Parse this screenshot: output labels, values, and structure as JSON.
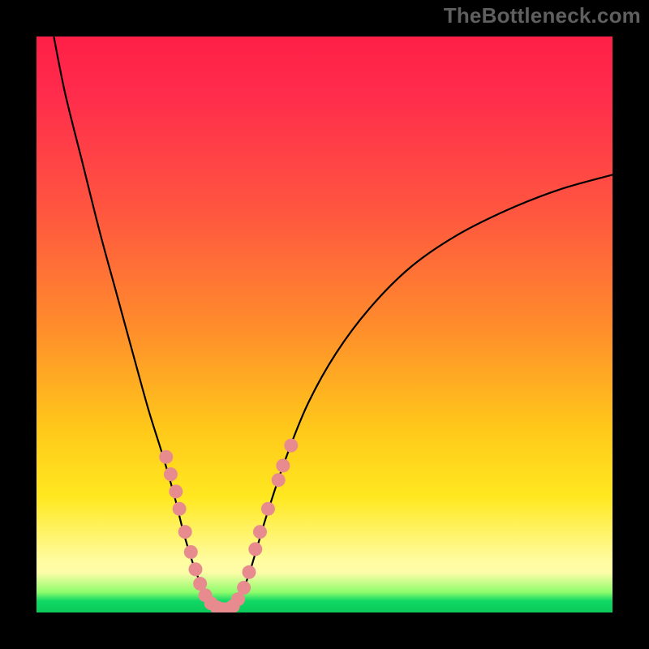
{
  "watermark": "TheBottleneck.com",
  "colors": {
    "frame": "#000000",
    "curve": "#000000",
    "marker": "#e88b8f",
    "gradient_top": "#ff1f47",
    "gradient_bottom": "#0bc95a"
  },
  "chart_data": {
    "type": "line",
    "title": "",
    "xlabel": "",
    "ylabel": "",
    "xlim": [
      0,
      100
    ],
    "ylim": [
      0,
      100
    ],
    "series": [
      {
        "name": "left-arm",
        "x": [
          3,
          5,
          8,
          11,
          14,
          17,
          19.5,
          22,
          24,
          25.5,
          27,
          28.5,
          30,
          31
        ],
        "y": [
          100,
          90,
          78,
          66,
          55,
          44,
          35,
          27,
          20,
          14,
          9,
          5,
          2,
          0.5
        ]
      },
      {
        "name": "right-arm",
        "x": [
          34,
          35.5,
          37,
          38.5,
          40,
          43,
          47,
          52,
          58,
          65,
          73,
          82,
          91,
          100
        ],
        "y": [
          0.5,
          3,
          7,
          12,
          17,
          26,
          36,
          45,
          53,
          60,
          65.5,
          70,
          73.5,
          76
        ]
      }
    ],
    "markers": {
      "name": "highlight-points",
      "points": [
        {
          "x": 22.5,
          "y": 27
        },
        {
          "x": 23.3,
          "y": 24
        },
        {
          "x": 24.2,
          "y": 21
        },
        {
          "x": 24.8,
          "y": 18
        },
        {
          "x": 25.8,
          "y": 14
        },
        {
          "x": 26.8,
          "y": 10.5
        },
        {
          "x": 27.6,
          "y": 7.5
        },
        {
          "x": 28.4,
          "y": 5
        },
        {
          "x": 29.3,
          "y": 3
        },
        {
          "x": 30.3,
          "y": 1.6
        },
        {
          "x": 31.3,
          "y": 0.9
        },
        {
          "x": 32.3,
          "y": 0.6
        },
        {
          "x": 33.2,
          "y": 0.6
        },
        {
          "x": 34.1,
          "y": 1.1
        },
        {
          "x": 35.0,
          "y": 2.3
        },
        {
          "x": 36.0,
          "y": 4.3
        },
        {
          "x": 36.9,
          "y": 7
        },
        {
          "x": 38.0,
          "y": 11
        },
        {
          "x": 38.8,
          "y": 14
        },
        {
          "x": 40.2,
          "y": 18
        },
        {
          "x": 42.0,
          "y": 23
        },
        {
          "x": 42.8,
          "y": 25.5
        },
        {
          "x": 44.2,
          "y": 29
        }
      ]
    }
  }
}
